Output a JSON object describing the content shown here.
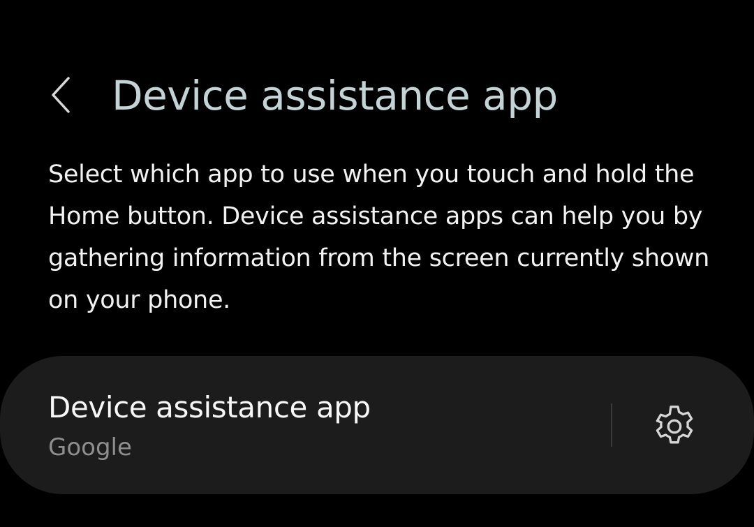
{
  "header": {
    "back_icon": "chevron-left-icon",
    "title": "Device assistance app"
  },
  "description": "Select which app to use when you touch and hold the Home button. Device assistance apps can help you by gathering information from the screen currently shown on your phone.",
  "setting_card": {
    "title": "Device assistance app",
    "value": "Google",
    "settings_icon": "gear-icon"
  },
  "colors": {
    "background": "#000000",
    "title": "#c4d3d6",
    "card_background": "#1c1c1c",
    "secondary_text": "#8e8e8e"
  }
}
